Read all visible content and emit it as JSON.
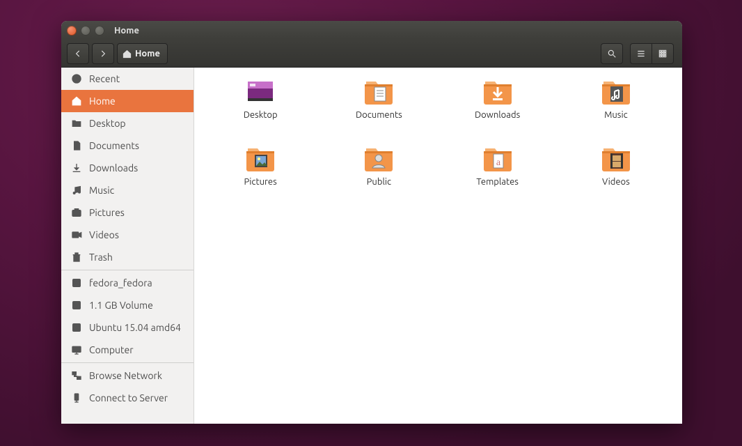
{
  "window": {
    "title": "Home"
  },
  "pathbar": {
    "location_label": "Home"
  },
  "sidebar": {
    "groups": [
      [
        {
          "icon": "clock",
          "label": "Recent",
          "selected": false
        },
        {
          "icon": "home",
          "label": "Home",
          "selected": true
        },
        {
          "icon": "folder",
          "label": "Desktop",
          "selected": false
        },
        {
          "icon": "doc",
          "label": "Documents",
          "selected": false
        },
        {
          "icon": "download",
          "label": "Downloads",
          "selected": false
        },
        {
          "icon": "music",
          "label": "Music",
          "selected": false
        },
        {
          "icon": "camera",
          "label": "Pictures",
          "selected": false
        },
        {
          "icon": "video",
          "label": "Videos",
          "selected": false
        },
        {
          "icon": "trash",
          "label": "Trash",
          "selected": false
        }
      ],
      [
        {
          "icon": "disk",
          "label": "fedora_fedora",
          "selected": false
        },
        {
          "icon": "disk",
          "label": "1.1 GB Volume",
          "selected": false
        },
        {
          "icon": "disk",
          "label": "Ubuntu 15.04 amd64",
          "selected": false
        },
        {
          "icon": "computer",
          "label": "Computer",
          "selected": false
        }
      ],
      [
        {
          "icon": "network",
          "label": "Browse Network",
          "selected": false
        },
        {
          "icon": "server",
          "label": "Connect to Server",
          "selected": false
        }
      ]
    ]
  },
  "content": {
    "items": [
      {
        "name": "Desktop",
        "kind": "desktop"
      },
      {
        "name": "Documents",
        "kind": "documents"
      },
      {
        "name": "Downloads",
        "kind": "downloads"
      },
      {
        "name": "Music",
        "kind": "music"
      },
      {
        "name": "Pictures",
        "kind": "pictures"
      },
      {
        "name": "Public",
        "kind": "public"
      },
      {
        "name": "Templates",
        "kind": "templates"
      },
      {
        "name": "Videos",
        "kind": "videos"
      }
    ]
  }
}
